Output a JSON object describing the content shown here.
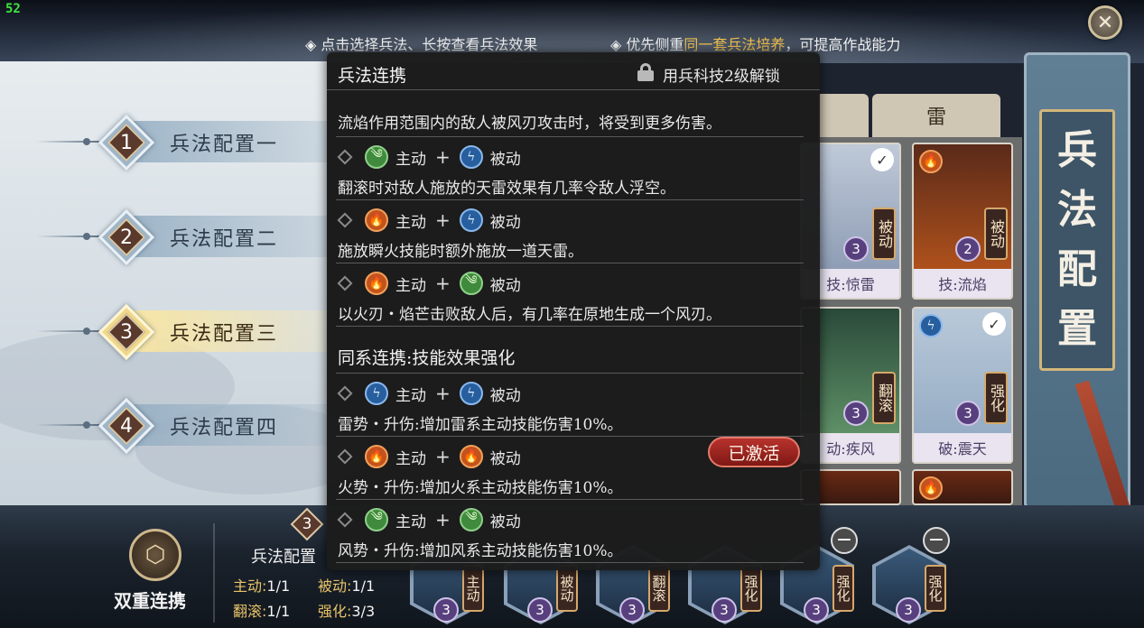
{
  "hud": {
    "fps": "52"
  },
  "hints": {
    "left": "点击选择兵法、长按查看兵法效果",
    "right_prefix": "优先侧重",
    "right_highlight": "同一套兵法培养",
    "right_suffix": "，可提高作战能力"
  },
  "configs": [
    {
      "num": "1",
      "label": "兵法配置一"
    },
    {
      "num": "2",
      "label": "兵法配置二"
    },
    {
      "num": "3",
      "label": "兵法配置三"
    },
    {
      "num": "4",
      "label": "兵法配置四"
    }
  ],
  "tabs": {
    "thunder": "雷"
  },
  "cards": [
    {
      "title": "技:惊雷",
      "tag": "被动",
      "level": "3",
      "checked": true
    },
    {
      "title": "技:流焰",
      "tag": "被动",
      "level": "2",
      "checked": false
    },
    {
      "title": "动:疾风",
      "tag": "翻滚",
      "level": "3",
      "checked": false
    },
    {
      "title": "破:震天",
      "tag": "强化",
      "level": "3",
      "checked": true
    }
  ],
  "scroll_title": [
    "兵",
    "法",
    "配",
    "置"
  ],
  "popup": {
    "title": "兵法连携",
    "lock_text": "用兵科技2级解锁",
    "active_word": "主动",
    "passive_word": "被动",
    "plus": "+",
    "entries": [
      {
        "desc": "流焰作用范围内的敌人被风刃攻击时，将受到更多伤害。"
      },
      {
        "a": "wind",
        "b": "thunder",
        "desc": "翻滚时对敌人施放的天雷效果有几率令敌人浮空。"
      },
      {
        "a": "fire",
        "b": "thunder",
        "desc": "施放瞬火技能时额外施放一道天雷。"
      },
      {
        "a": "fire",
        "b": "wind",
        "desc": "以火刃・焰芒击败敌人后，有几率在原地生成一个风刃。"
      }
    ],
    "section_title": "同系连携:技能效果强化",
    "same_entries": [
      {
        "a": "thunder",
        "b": "thunder",
        "desc": "雷势・升伤:增加雷系主动技能伤害10%。"
      },
      {
        "a": "fire",
        "b": "fire",
        "desc": "火势・升伤:增加火系主动技能伤害10%。",
        "status": "已激活"
      },
      {
        "a": "wind",
        "b": "wind",
        "desc": "风势・升伤:增加风系主动技能伤害10%。"
      }
    ]
  },
  "bottom": {
    "link_label": "双重连携",
    "config_num": "3",
    "config_name": "兵法配置",
    "stats": {
      "active": {
        "k": "主动:",
        "v": "1/1"
      },
      "passive": {
        "k": "被动:",
        "v": "1/1"
      },
      "roll": {
        "k": "翻滚:",
        "v": "1/1"
      },
      "enhance": {
        "k": "强化:",
        "v": "3/3"
      }
    },
    "slots": [
      {
        "tag": "主动",
        "level": "3"
      },
      {
        "tag": "被动",
        "level": "3"
      },
      {
        "tag": "翻滚",
        "level": "3"
      },
      {
        "tag": "强化",
        "level": "3"
      },
      {
        "tag": "强化",
        "level": "3"
      },
      {
        "tag": "强化",
        "level": "3"
      }
    ]
  },
  "colors": {
    "highlight": "#f0c050",
    "activated": "#b8322c"
  }
}
